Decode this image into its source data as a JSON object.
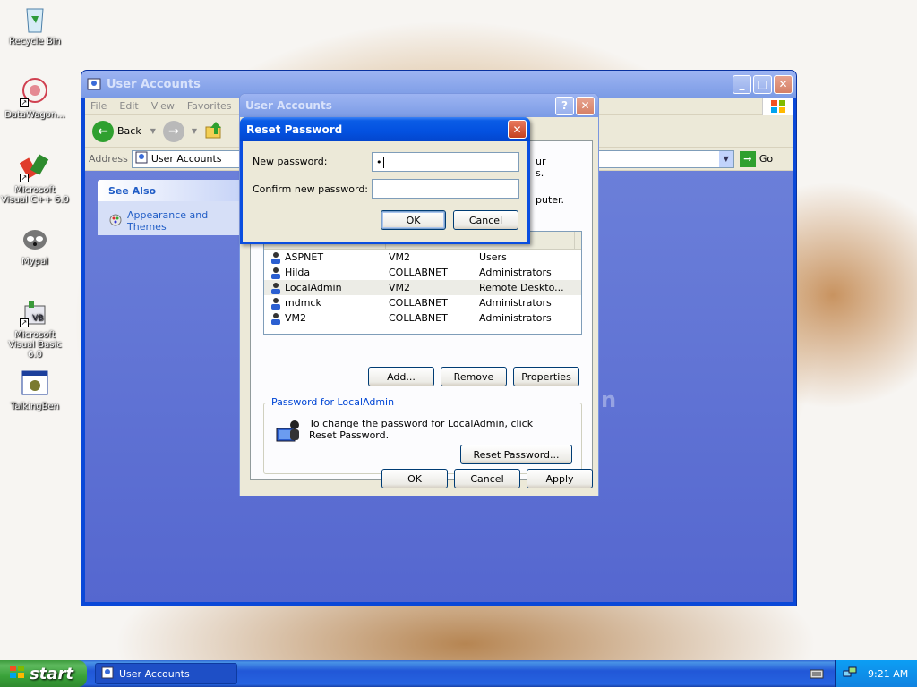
{
  "desktop_icons": [
    {
      "label": "Recycle Bin",
      "icon": "recycle-bin-icon"
    },
    {
      "label": "DataWagon...",
      "icon": "datawagon-icon"
    },
    {
      "label": "Microsoft Visual C++ 6.0",
      "icon": "visual-cpp-icon"
    },
    {
      "label": "Mypal",
      "icon": "mypal-icon"
    },
    {
      "label": "Microsoft Visual Basic 6.0",
      "icon": "visual-basic-icon"
    },
    {
      "label": "TalkingBen",
      "icon": "talkingben-icon"
    }
  ],
  "main_window": {
    "title": "User Accounts",
    "menu": [
      "File",
      "Edit",
      "View",
      "Favorites"
    ],
    "toolbar": {
      "back_label": "Back"
    },
    "address": {
      "label": "Address",
      "value": "User Accounts",
      "go_label": "Go"
    },
    "see_also": {
      "title": "See Also",
      "link": "Appearance and Themes"
    },
    "watermark_fragment": "n"
  },
  "ua_dialog": {
    "title": "User Accounts",
    "partial_text": [
      "ur",
      "s.",
      "puter."
    ],
    "users": [
      {
        "name": "ASPNET",
        "domain": "VM2",
        "group": "Users"
      },
      {
        "name": "Hilda",
        "domain": "COLLABNET",
        "group": "Administrators"
      },
      {
        "name": "LocalAdmin",
        "domain": "VM2",
        "group": "Remote Deskto..."
      },
      {
        "name": "mdmck",
        "domain": "COLLABNET",
        "group": "Administrators"
      },
      {
        "name": "VM2",
        "domain": "COLLABNET",
        "group": "Administrators"
      }
    ],
    "selected_user": "LocalAdmin",
    "buttons": {
      "add": "Add...",
      "remove": "Remove",
      "properties": "Properties"
    },
    "password_group": {
      "legend": "Password for LocalAdmin",
      "text": "To change the password for LocalAdmin, click Reset Password.",
      "reset_button": "Reset Password..."
    },
    "bottom_buttons": {
      "ok": "OK",
      "cancel": "Cancel",
      "apply": "Apply"
    }
  },
  "reset_dialog": {
    "title": "Reset Password",
    "new_password_label": "New password:",
    "new_password_value": "•",
    "confirm_label": "Confirm new password:",
    "confirm_value": "",
    "ok": "OK",
    "cancel": "Cancel"
  },
  "taskbar": {
    "start_label": "start",
    "task_label": "User Accounts",
    "clock": "9:21 AM"
  },
  "colors": {
    "xp_blue": "#0a48d8",
    "start_green": "#3c9a3c",
    "dialog_bg": "#ece9d8"
  }
}
